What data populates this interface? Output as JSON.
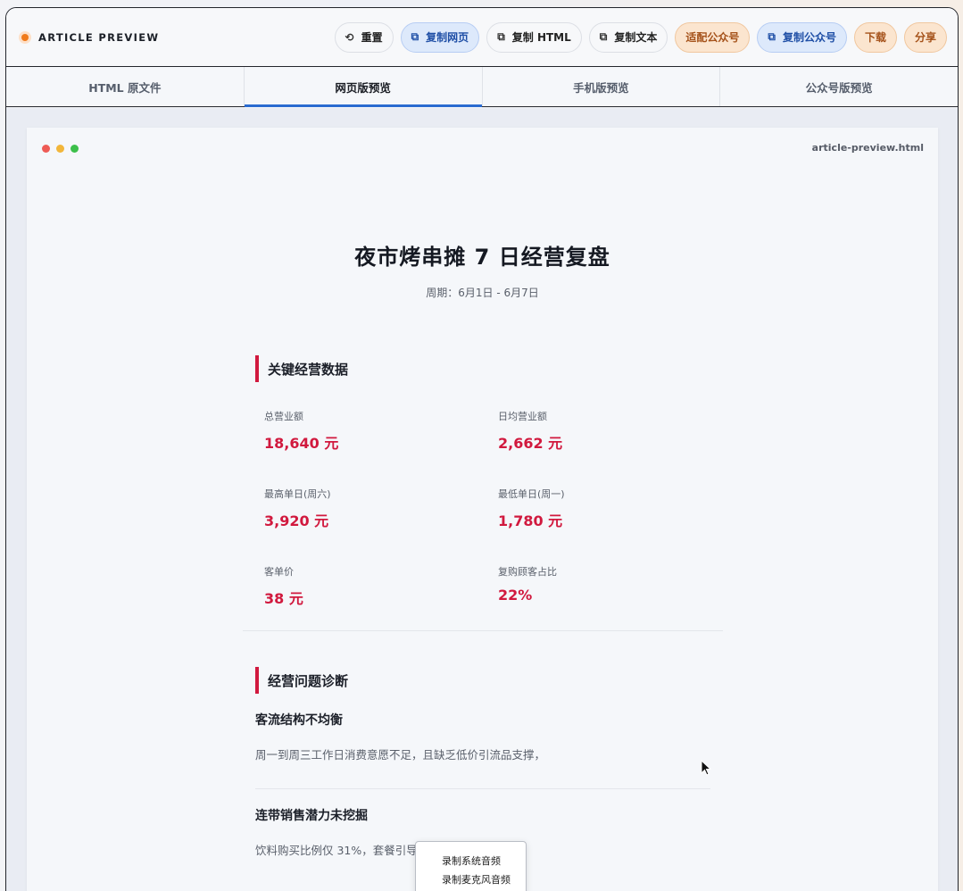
{
  "brand": {
    "title": "ARTICLE PREVIEW"
  },
  "toolbar": {
    "reset": "重置",
    "copy_web": "复制网页",
    "copy_html": "复制 HTML",
    "copy_text": "复制文本",
    "fit_wechat": "适配公众号",
    "copy_wechat": "复制公众号",
    "download": "下载",
    "share": "分享"
  },
  "tabs": [
    {
      "label": "HTML 原文件",
      "active": false
    },
    {
      "label": "网页版预览",
      "active": true
    },
    {
      "label": "手机版预览",
      "active": false
    },
    {
      "label": "公众号版预览",
      "active": false
    }
  ],
  "preview": {
    "filename": "article-preview.html"
  },
  "article": {
    "title": "夜市烤串摊 7 日经营复盘",
    "period": "周期：6月1日 - 6月7日",
    "sections": [
      {
        "heading": "关键经营数据",
        "stats": [
          {
            "label": "总营业额",
            "value": "18,640 元"
          },
          {
            "label": "日均营业额",
            "value": "2,662 元"
          },
          {
            "label": "最高单日(周六)",
            "value": "3,920 元"
          },
          {
            "label": "最低单日(周一)",
            "value": "1,780 元"
          },
          {
            "label": "客单价",
            "value": "38 元"
          },
          {
            "label": "复购顾客占比",
            "value": "22%"
          }
        ]
      },
      {
        "heading": "经营问题诊断",
        "issues": [
          {
            "title": "客流结构不均衡",
            "text": "周一到周三工作日消费意愿不足，且缺乏低价引流品支撑，"
          },
          {
            "title": "连带销售潜力未挖掘",
            "text": "饮料购买比例仅 31%，套餐引导"
          }
        ]
      }
    ]
  },
  "context_menu": {
    "items": [
      "录制系统音频",
      "录制麦克风音频"
    ]
  },
  "colors": {
    "accent": "#d1193e",
    "tab_active": "#2a6bd0",
    "brand_dot": "#f07a1a",
    "window_dots": [
      "#ee5b55",
      "#f2b63a",
      "#3cbf4a"
    ]
  }
}
